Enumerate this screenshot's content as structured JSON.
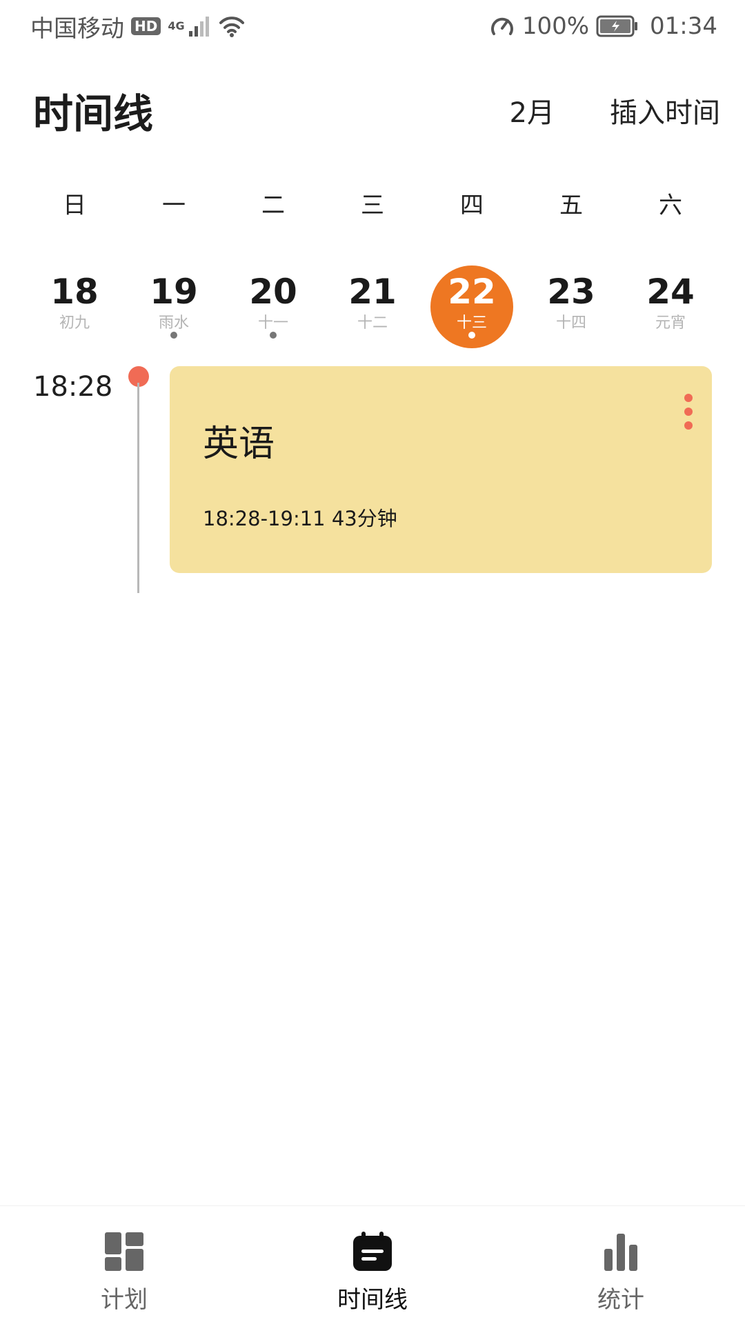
{
  "status_bar": {
    "carrier": "中国移动",
    "hd": "HD",
    "net_type": "4G",
    "battery": "100%",
    "time": "01:34"
  },
  "header": {
    "title": "时间线",
    "month": "2月",
    "insert_time": "插入时间"
  },
  "week": {
    "weekdays": [
      "日",
      "一",
      "二",
      "三",
      "四",
      "五",
      "六"
    ],
    "dates": [
      {
        "day": "18",
        "lunar": "初九",
        "has_event": false,
        "selected": false
      },
      {
        "day": "19",
        "lunar": "雨水",
        "has_event": true,
        "selected": false
      },
      {
        "day": "20",
        "lunar": "十一",
        "has_event": true,
        "selected": false
      },
      {
        "day": "21",
        "lunar": "十二",
        "has_event": false,
        "selected": false
      },
      {
        "day": "22",
        "lunar": "十三",
        "has_event": true,
        "selected": true
      },
      {
        "day": "23",
        "lunar": "十四",
        "has_event": false,
        "selected": false
      },
      {
        "day": "24",
        "lunar": "元宵",
        "has_event": false,
        "selected": false
      }
    ]
  },
  "timeline": {
    "entries": [
      {
        "time": "18:28",
        "title": "英语",
        "duration": "18:28-19:11 43分钟"
      }
    ]
  },
  "bottom_nav": {
    "items": [
      {
        "label": "计划",
        "icon": "dashboard-icon",
        "active": false
      },
      {
        "label": "时间线",
        "icon": "calendar-icon",
        "active": true
      },
      {
        "label": "统计",
        "icon": "bar-chart-icon",
        "active": false
      }
    ]
  },
  "colors": {
    "accent": "#ee7722",
    "node": "#f06b55",
    "card": "#f5e19e"
  }
}
